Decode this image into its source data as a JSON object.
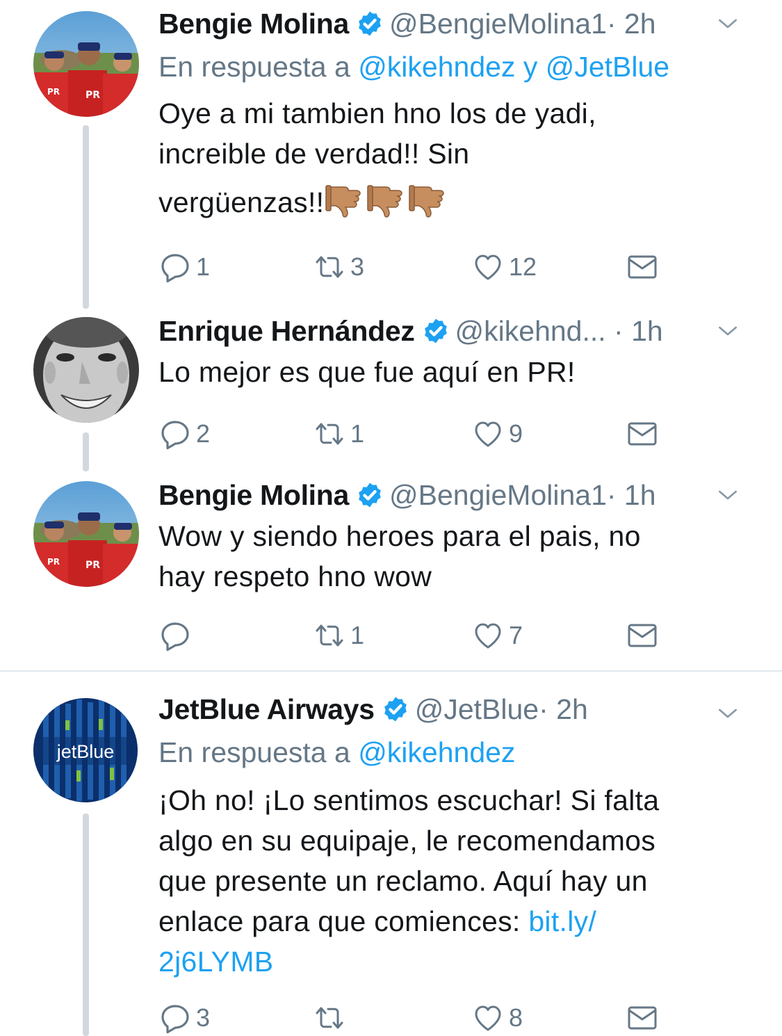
{
  "tweets": [
    {
      "name": "Bengie Molina",
      "handle": "@BengieMolina1",
      "time": "· 2h",
      "reply_prefix": "En respuesta a ",
      "reply_user1": "@kikehndez",
      "reply_and": " y ",
      "reply_user2": "@JetBlue",
      "text_line1": "Oye a mi tambien hno los de yadi,",
      "text_line2": "increible de verdad!! Sin",
      "text_line3": "vergüenzas!!",
      "replies": "1",
      "retweets": "3",
      "likes": "12"
    },
    {
      "name": "Enrique Hernández",
      "handle": "@kikehnd...",
      "time": " · 1h",
      "text_line1": "Lo mejor es que fue aquí en PR!",
      "replies": "2",
      "retweets": "1",
      "likes": "9"
    },
    {
      "name": "Bengie Molina",
      "handle": "@BengieMolina1",
      "time": "· 1h",
      "text_line1": "Wow y siendo heroes para el pais, no",
      "text_line2": "hay respeto hno wow",
      "replies": "",
      "retweets": "1",
      "likes": "7"
    },
    {
      "name": "JetBlue Airways",
      "handle": "@JetBlue",
      "time": "· 2h",
      "reply_prefix": "En respuesta a ",
      "reply_user1": "@kikehndez",
      "text_line1": "¡Oh no! ¡Lo sentimos escuchar! Si falta",
      "text_line2": "algo en su equipaje, le recomendamos",
      "text_line3": "que presente un reclamo. Aquí hay un",
      "text_line4": "enlace para que comiences: ",
      "link_part1": "bit.ly/",
      "link_part2": "2j6LYMB",
      "avatar_logo": "jetBlue",
      "replies": "3",
      "retweets": "",
      "likes": "8"
    }
  ],
  "icons": {
    "verified": "verified-badge-icon",
    "chevron": "chevron-down-icon",
    "reply": "reply-icon",
    "retweet": "retweet-icon",
    "like": "heart-icon",
    "dm": "envelope-icon",
    "thumbs_down": "thumbs-down-emoji"
  },
  "colors": {
    "link": "#1da1f2",
    "secondary": "#657786",
    "verified": "#1da1f2",
    "thread_line": "#d2d8dd",
    "divider": "#e1e8ed"
  }
}
